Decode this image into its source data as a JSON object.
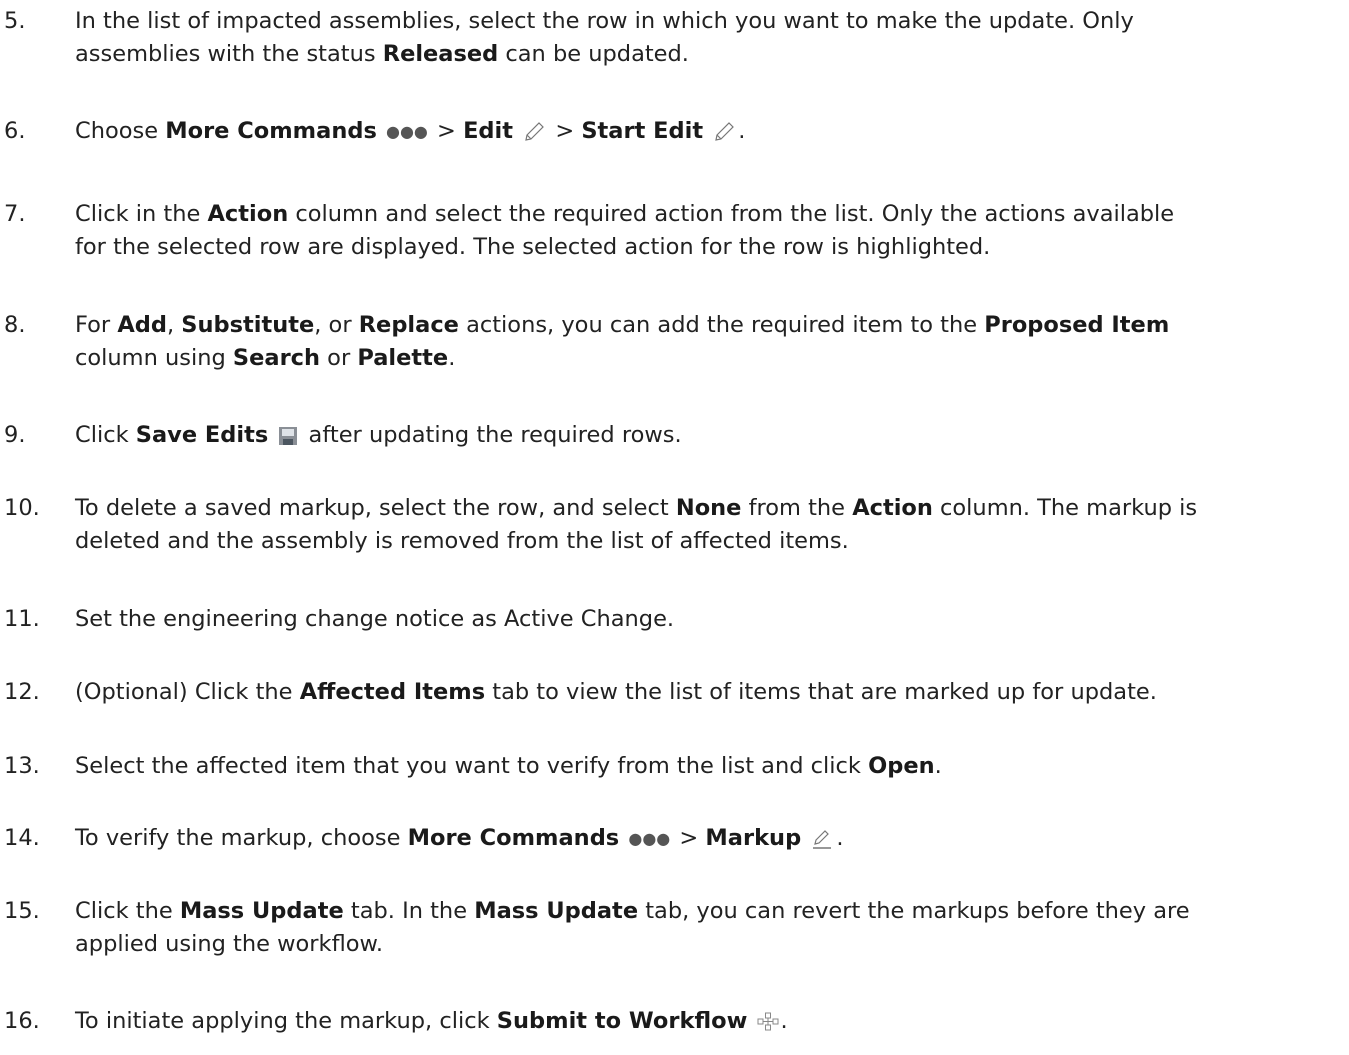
{
  "steps": [
    {
      "num": "5.",
      "t": [
        "In the list of impacted assemblies, select the row in which you want to make the update. Only",
        "assemblies with the status ",
        "Released",
        " can be updated."
      ]
    },
    {
      "num": "6.",
      "t": [
        "Choose ",
        "More Commands",
        " > ",
        "Edit",
        " > ",
        "Start Edit",
        "."
      ]
    },
    {
      "num": "7.",
      "t": [
        "Click in the ",
        "Action",
        " column and select the required action from the list. Only the actions available",
        "for the selected row are displayed. The selected action for the row is highlighted."
      ]
    },
    {
      "num": "8.",
      "t": [
        "For ",
        "Add",
        ", ",
        "Substitute",
        ", or ",
        "Replace",
        " actions, you can add the required item to the ",
        "Proposed Item",
        "column using ",
        "Search",
        " or ",
        "Palette",
        "."
      ]
    },
    {
      "num": "9.",
      "t": [
        "Click ",
        "Save Edits",
        " after updating the required rows."
      ]
    },
    {
      "num": "10.",
      "t": [
        "To delete a saved markup, select the row, and select ",
        "None",
        " from the ",
        "Action",
        " column. The markup is",
        "deleted and the assembly is removed from the list of affected items."
      ]
    },
    {
      "num": "11.",
      "t": [
        "Set the engineering change notice as Active Change."
      ]
    },
    {
      "num": "12.",
      "t": [
        "(Optional) Click the ",
        "Affected Items",
        " tab to view the list of items that are marked up for update."
      ]
    },
    {
      "num": "13.",
      "t": [
        "Select the affected item that you want to verify from the list and click ",
        "Open",
        "."
      ]
    },
    {
      "num": "14.",
      "t": [
        "To verify the markup, choose ",
        "More Commands",
        " > ",
        "Markup",
        "."
      ]
    },
    {
      "num": "15.",
      "t": [
        "Click the ",
        "Mass Update",
        " tab. In the ",
        "Mass Update",
        " tab, you can revert the markups before they are",
        "applied using the workflow."
      ]
    },
    {
      "num": "16.",
      "t": [
        "To initiate applying the markup, click ",
        "Submit to Workflow",
        "."
      ]
    }
  ],
  "icons": {
    "more": "more-commands-icon",
    "edit": "pencil-icon",
    "save": "save-icon",
    "markup": "markup-icon",
    "workflow": "workflow-icon"
  }
}
